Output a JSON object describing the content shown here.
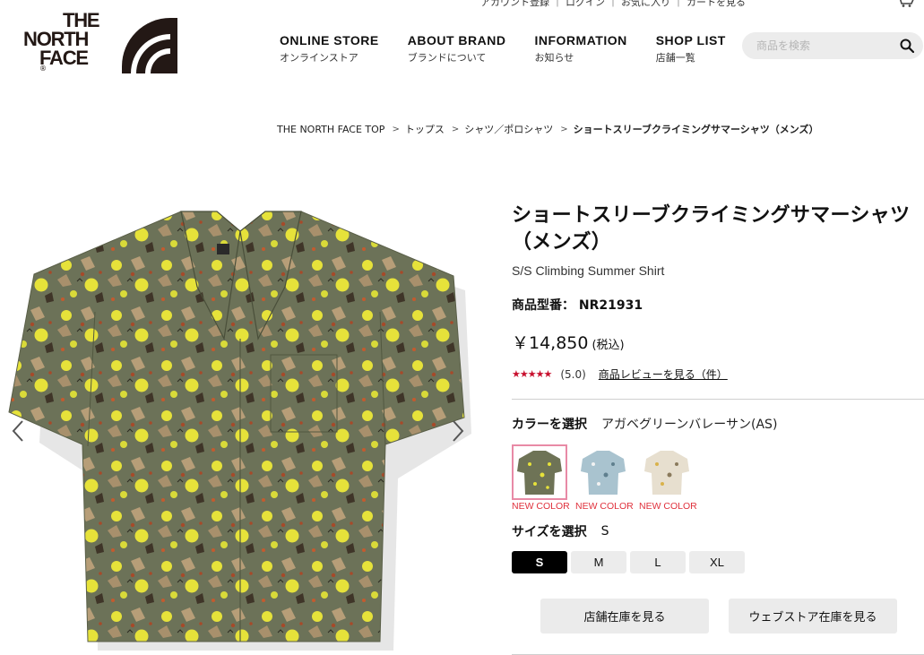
{
  "header": {
    "logo": {
      "line1": "THE",
      "line2": "NORTH",
      "line3": "FACE",
      "reg": "®"
    },
    "topline": "アカウント登録 ｜ ログイン ｜ お気に入り ｜ カートを見る",
    "nav": [
      {
        "en": "ONLINE STORE",
        "jp": "オンラインストア"
      },
      {
        "en": "ABOUT BRAND",
        "jp": "ブランドについて"
      },
      {
        "en": "INFORMATION",
        "jp": "お知らせ"
      },
      {
        "en": "SHOP LIST",
        "jp": "店舗一覧"
      }
    ],
    "search": {
      "placeholder": "商品を検索",
      "icon": "search-icon"
    }
  },
  "breadcrumb": {
    "items": [
      "THE NORTH FACE TOP",
      "トップス",
      "シャツ／ポロシャツ"
    ],
    "current": "ショートスリーブクライミングサマーシャツ（メンズ）",
    "separator": ">"
  },
  "product": {
    "title_line1": "ショートスリーブクライミングサマーシャツ",
    "title_line2": "（メンズ）",
    "subtitle": "S/S Climbing Summer Shirt",
    "model_label": "商品型番：",
    "model_value": "NR21931",
    "price": "￥14,850",
    "tax": "(税込)",
    "stars": "★★★★★",
    "rating": "(5.0)",
    "review_link": "商品レビューを見る（件）",
    "color_label": "カラーを選択",
    "color_value": "アガベグリーンバレーサン(AS)",
    "swatches": [
      {
        "tag": "NEW COLOR",
        "color": "#6e7356"
      },
      {
        "tag": "NEW COLOR",
        "color": "#a9c3cf"
      },
      {
        "tag": "NEW COLOR",
        "color": "#e7dfcf"
      }
    ],
    "size_label": "サイズを選択",
    "size_value": "S",
    "sizes": [
      "S",
      "M",
      "L",
      "XL"
    ],
    "store_stock": "店舗在庫を見る",
    "web_stock": "ウェブストア在庫を見る"
  },
  "colors": {
    "shirt_base": "#6c7258",
    "accent_yellow": "#e6e23a",
    "new_color_red": "#e0313c",
    "star_red": "#c8102e",
    "selected_border": "#e88aa6"
  }
}
